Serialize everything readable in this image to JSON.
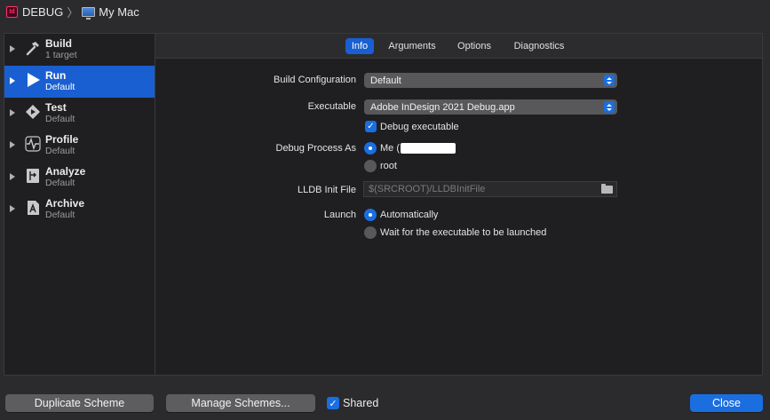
{
  "titlebar": {
    "app_icon_text": "Id",
    "scheme": "DEBUG",
    "separator": "〉",
    "destination": "My Mac"
  },
  "sidebar": {
    "items": [
      {
        "title": "Build",
        "subtitle": "1 target",
        "icon": "hammer-icon",
        "selected": false
      },
      {
        "title": "Run",
        "subtitle": "Default",
        "icon": "play-icon",
        "selected": true
      },
      {
        "title": "Test",
        "subtitle": "Default",
        "icon": "test-diamond-icon",
        "selected": false
      },
      {
        "title": "Profile",
        "subtitle": "Default",
        "icon": "waveform-icon",
        "selected": false
      },
      {
        "title": "Analyze",
        "subtitle": "Default",
        "icon": "analyze-icon",
        "selected": false
      },
      {
        "title": "Archive",
        "subtitle": "Default",
        "icon": "archive-icon",
        "selected": false
      }
    ]
  },
  "tabs": [
    {
      "label": "Info",
      "active": true
    },
    {
      "label": "Arguments",
      "active": false
    },
    {
      "label": "Options",
      "active": false
    },
    {
      "label": "Diagnostics",
      "active": false
    }
  ],
  "form": {
    "build_config_label": "Build Configuration",
    "build_config_value": "Default",
    "executable_label": "Executable",
    "executable_value": "Adobe InDesign 2021 Debug.app",
    "debug_executable_label": "Debug executable",
    "debug_executable_checked": true,
    "debug_process_label": "Debug Process As",
    "process_me_label": "Me (",
    "process_root_label": "root",
    "lldb_label": "LLDB Init File",
    "lldb_placeholder": "$(SRCROOT)/LLDBInitFile",
    "launch_label": "Launch",
    "launch_auto_label": "Automatically",
    "launch_wait_label": "Wait for the executable to be launched"
  },
  "bottom": {
    "duplicate_label": "Duplicate Scheme",
    "manage_label": "Manage Schemes...",
    "shared_label": "Shared",
    "shared_checked": true,
    "close_label": "Close"
  },
  "colors": {
    "accent": "#1a6ee0",
    "selection": "#1a5fd1",
    "panel": "#1f1f21",
    "window": "#2b2b2d"
  }
}
